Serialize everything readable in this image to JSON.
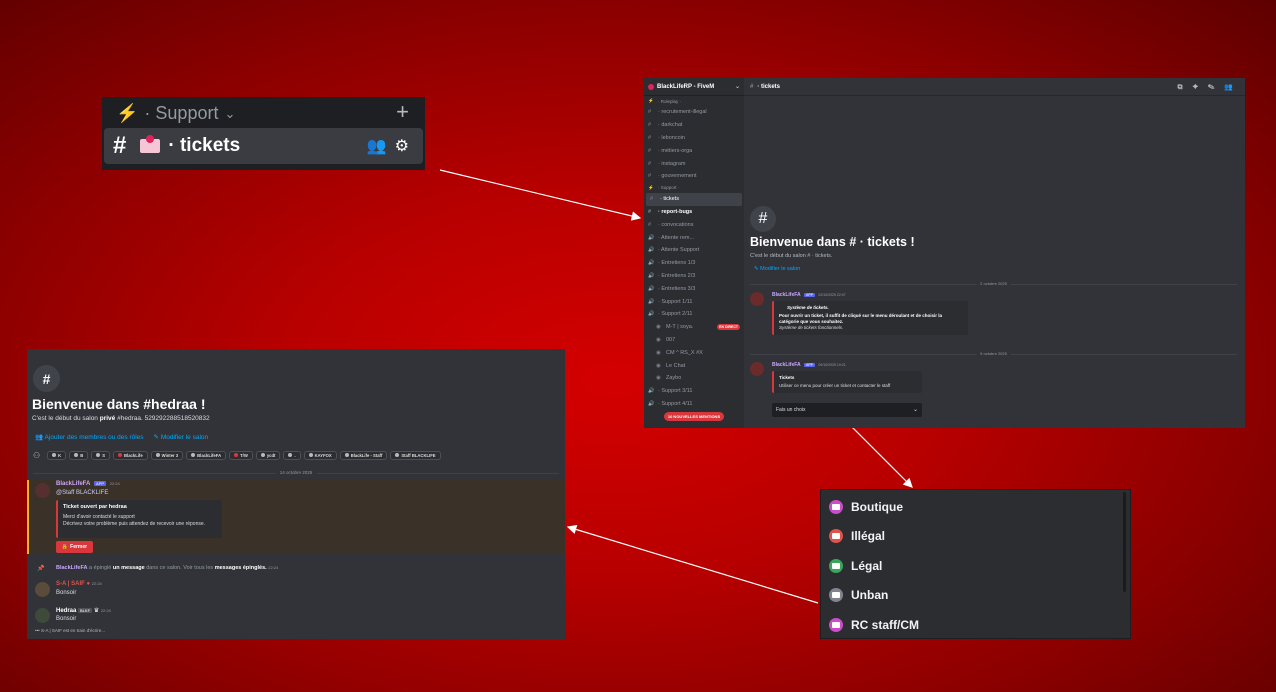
{
  "colors": {
    "background_red": "#c40000",
    "discord_dark": "#313338",
    "sidebar": "#2b2d31",
    "link_blue": "#00a8fc",
    "danger_red": "#da373c",
    "bot_purple": "#c9a6ff",
    "app_badge": "#5865f2"
  },
  "zoom_panel": {
    "category_label": "· Support",
    "channel_name": "· tickets"
  },
  "discord_window": {
    "server_name": "BlackLifeRP - FiveM",
    "channel_header": "· tickets",
    "channels": [
      {
        "kind": "category",
        "label": "· Roleplay ·"
      },
      {
        "kind": "text",
        "label": "· recrutement-illegal"
      },
      {
        "kind": "text",
        "label": "· darkchat"
      },
      {
        "kind": "text",
        "label": "· leboncoin"
      },
      {
        "kind": "text",
        "label": "· métiers-orga"
      },
      {
        "kind": "text",
        "label": "· instagram"
      },
      {
        "kind": "text",
        "label": "· gouvernement"
      },
      {
        "kind": "category",
        "label": "· Support ·"
      },
      {
        "kind": "text",
        "label": "· tickets",
        "active": true
      },
      {
        "kind": "text",
        "label": "· report-bugs",
        "bold": true
      },
      {
        "kind": "text",
        "label": "· convocations"
      },
      {
        "kind": "voice",
        "label": "· Attente rem..."
      },
      {
        "kind": "voice",
        "label": "· Attente Support"
      },
      {
        "kind": "voice",
        "label": "· Entretiens 1/3"
      },
      {
        "kind": "voice",
        "label": "· Entretiens 2/3"
      },
      {
        "kind": "voice",
        "label": "· Entretiens 3/3"
      },
      {
        "kind": "voice",
        "label": "· Support 1/11"
      },
      {
        "kind": "voice",
        "label": "· Support 2/11"
      },
      {
        "kind": "user",
        "label": "M-T | soya."
      },
      {
        "kind": "user",
        "label": "007"
      },
      {
        "kind": "user",
        "label": "CM ^ RS_X #X"
      },
      {
        "kind": "user",
        "label": "Le Chat"
      },
      {
        "kind": "user",
        "label": "Zaybo"
      },
      {
        "kind": "voice",
        "label": "· Support 3/11"
      },
      {
        "kind": "voice",
        "label": "· Support 4/11"
      }
    ],
    "live_badge": "EN DIRECT",
    "new_mentions": "10 NOUVELLES MENTIONS",
    "welcome_title": "Bienvenue dans # · tickets !",
    "welcome_sub": "C'est le début du salon # · tickets.",
    "edit_channel": "Modifier le salon",
    "date_1": "2 octobre 2025",
    "date_2": "9 octobre 2025",
    "msg1": {
      "author": "BlackLifeFA",
      "badge": "APP",
      "time": "02/10/2025 22:07",
      "embed_title": "Système de tickets.",
      "embed_body": "Pour ouvrir un ticket, il suffit de cliqué sur le menu déroulant et de choisir la catégorie que vous souhaitez.",
      "embed_footer": "Système de tickets fonctionnels."
    },
    "msg2": {
      "author": "BlackLifeFA",
      "badge": "APP",
      "time": "09/10/2025 19:21",
      "embed_title": "Tickets",
      "embed_body": "Utiliser ce menu pour créer un ticket et contacter le staff"
    },
    "select_placeholder": "Fais un choix"
  },
  "dropdown": {
    "options": [
      {
        "label": "Boutique",
        "color": "#c94fc8"
      },
      {
        "label": "Illégal",
        "color": "#e0524c"
      },
      {
        "label": "Légal",
        "color": "#3ba55c"
      },
      {
        "label": "Unban",
        "color": "#80848e"
      },
      {
        "label": "RC staff/CM",
        "color": "#c94fc8"
      }
    ]
  },
  "ticket_channel": {
    "welcome_title": "Bienvenue dans #hedraa !",
    "welcome_sub_prefix": "C'est le début du salon",
    "welcome_sub_private": "privé",
    "welcome_sub_rest": "#hedraa. 529292288518520832",
    "add_members": "Ajouter des membres ou des rôles",
    "edit_channel": "Modifier le salon",
    "roles": [
      "K",
      "B",
      "S",
      "BlackLife",
      "Winter 3",
      "BlackLifeFA",
      "T/W",
      "ycdt",
      ".",
      "KAYFOX",
      "BlackLife - Staff",
      "Staff BLACKLIFE"
    ],
    "date": "14 octobre 2025",
    "bot_author": "BlackLifeFA",
    "bot_badge": "APP",
    "bot_time": "22:24",
    "bot_mention": "@Staff BLACKLIFE",
    "embed_title": "Ticket ouvert par hedraa",
    "embed_line1": "Merci d'avoir contacté le support",
    "embed_line2": "Décrivez votre problème puis attendez de recevoir une réponse.",
    "close_button": "Fermer",
    "pin_author": "BlackLifeFA",
    "pin_text1": "a épinglé",
    "pin_text2": "un message",
    "pin_text3": "dans ce salon. Voir tous les",
    "pin_text4": "messages épinglés.",
    "pin_time": "22:24",
    "user2_name": "S-A | SAIF",
    "user2_time": "22:24",
    "user2_msg": "Bonsoir",
    "user3_name": "Hedraa",
    "user3_tag": "BLKF",
    "user3_time": "22:24",
    "user3_msg": "Bonsoir",
    "typing": "S-A | SAIF est en train d'écrire..."
  }
}
